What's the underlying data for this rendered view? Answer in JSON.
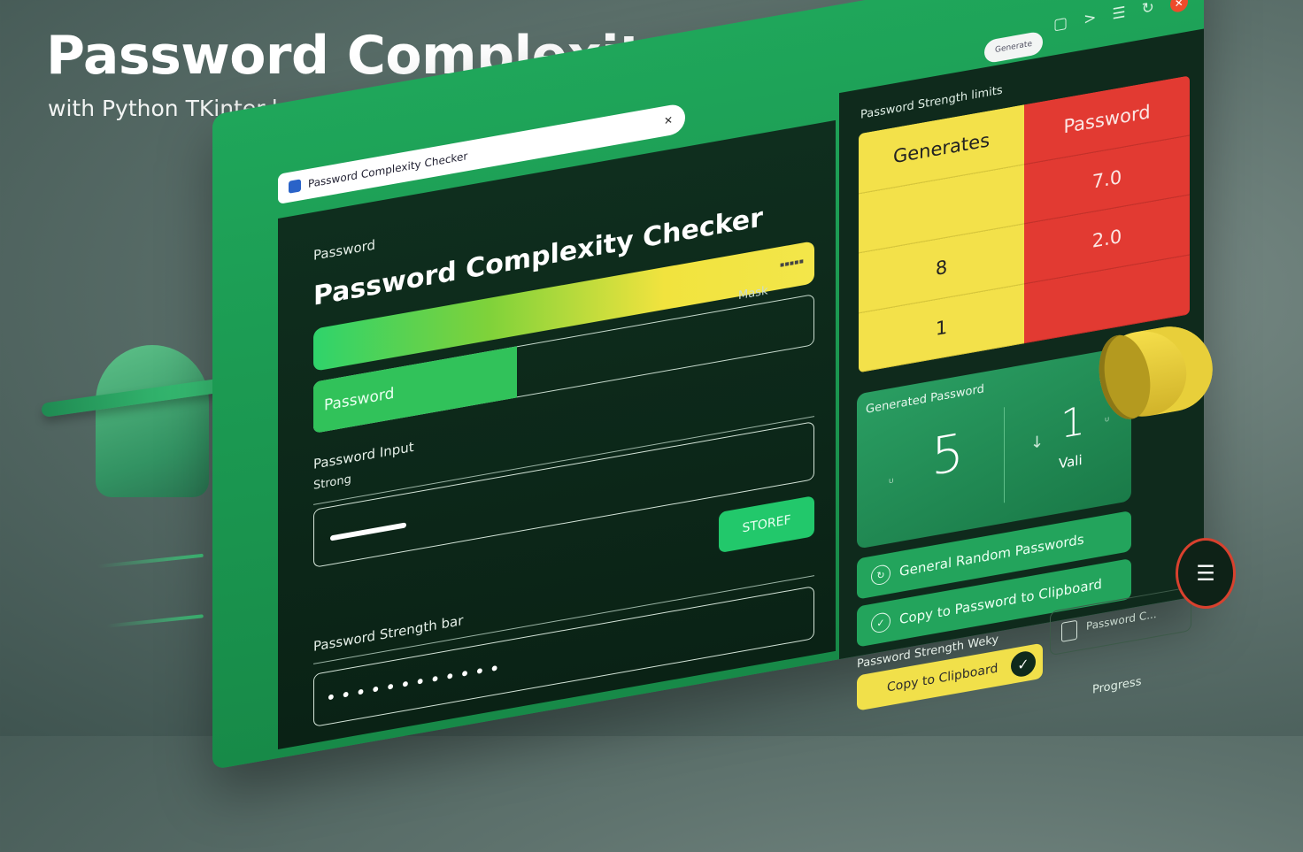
{
  "hero": {
    "title": "Password Complexity Checker",
    "subtitle": "with Python TKinter-based GUI"
  },
  "window": {
    "tab_title": "Password Complexity Checker",
    "tab_close": "✕",
    "pill_label": "Generate",
    "icons": [
      "save-icon",
      "play-icon",
      "menu-icon",
      "refresh-icon",
      "close-icon"
    ]
  },
  "left": {
    "password_label": "Password",
    "heading": "Password Complexity Checker",
    "bar_hint": "▪▪▪▪▪",
    "password_chip": "Password",
    "mask_toggle": "Mask",
    "input_label": "Password Input",
    "strong_label": "Strong",
    "store_button": "STOREF",
    "strength_bar_label": "Password Strength bar",
    "dots": "••••••••••••"
  },
  "right": {
    "stats_label": "Password Strength limits",
    "grid": [
      [
        "Generates",
        "Password"
      ],
      [
        "",
        "7.0"
      ],
      [
        "8",
        "2.0"
      ],
      [
        "1",
        ""
      ]
    ],
    "generated_title": "Generated Password",
    "big_number": "5",
    "second_number": "1",
    "value_label": "Vali",
    "generate_button": "General Random Passwords",
    "copy_button": "Copy to Password to Clipboard",
    "bottom_label": "Password Strength Weky",
    "copy_chip": "Copy to Clipboard",
    "checkbox_label": "Password C...",
    "progress_label": "Progress"
  },
  "colors": {
    "accent_green": "#1fa65a",
    "dark_panel": "#0f2a1c",
    "yellow": "#f3e14a",
    "red": "#e23a32"
  }
}
